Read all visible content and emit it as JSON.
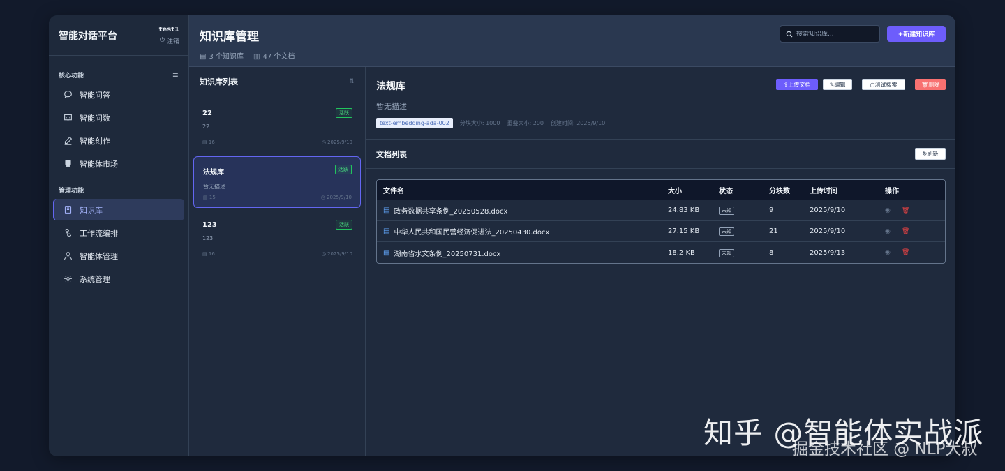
{
  "sidebar": {
    "brand": "智能对话平台",
    "user": "test1",
    "logout": "注销",
    "section_core": "核心功能",
    "core_items": [
      {
        "label": "智能问答",
        "icon": "chat-icon"
      },
      {
        "label": "智能问数",
        "icon": "chart-icon"
      },
      {
        "label": "智能创作",
        "icon": "pen-icon"
      },
      {
        "label": "智能体市场",
        "icon": "store-icon"
      }
    ],
    "section_manage": "管理功能",
    "manage_items": [
      {
        "label": "知识库",
        "icon": "book-icon",
        "active": true
      },
      {
        "label": "工作流编排",
        "icon": "workflow-icon"
      },
      {
        "label": "智能体管理",
        "icon": "user-icon"
      },
      {
        "label": "系统管理",
        "icon": "gear-icon"
      }
    ]
  },
  "header": {
    "title": "知识库管理",
    "kb_count": "3 个知识库",
    "doc_count": "47 个文档",
    "search_placeholder": "搜索知识库...",
    "new_button": "+新建知识库"
  },
  "kb_list": {
    "title": "知识库列表",
    "items": [
      {
        "name": "22",
        "desc": "22",
        "docs": "16",
        "date": "2025/9/10",
        "status": "活跃"
      },
      {
        "name": "法规库",
        "desc": "暂无描述",
        "docs": "15",
        "date": "2025/9/10",
        "status": "活跃"
      },
      {
        "name": "123",
        "desc": "123",
        "docs": "16",
        "date": "2025/9/10",
        "status": "活跃"
      }
    ]
  },
  "detail": {
    "title": "法规库",
    "desc": "暂无描述",
    "model": "text-embedding-ada-002",
    "chunk_size": "分块大小: 1000",
    "overlap": "重叠大小: 200",
    "created": "创建时间: 2025/9/10",
    "btn_upload": "上传文档",
    "btn_edit": "编辑",
    "btn_test": "测试搜索",
    "btn_delete": "删除"
  },
  "docs": {
    "title": "文档列表",
    "refresh": "刷新",
    "columns": [
      "文件名",
      "大小",
      "状态",
      "分块数",
      "上传时间",
      "操作"
    ],
    "rows": [
      {
        "name": "政务数据共享条例_20250528.docx",
        "size": "24.83 KB",
        "status": "未知",
        "chunks": "9",
        "time": "2025/9/10"
      },
      {
        "name": "中华人民共和国民营经济促进法_20250430.docx",
        "size": "27.15 KB",
        "status": "未知",
        "chunks": "21",
        "time": "2025/9/10"
      },
      {
        "name": "湖南省水文条例_20250731.docx",
        "size": "18.2 KB",
        "status": "未知",
        "chunks": "8",
        "time": "2025/9/13"
      }
    ]
  },
  "watermark": {
    "line1": "知乎 @智能体实战派",
    "line2": "掘金技术社区 @ NLP大叔"
  }
}
